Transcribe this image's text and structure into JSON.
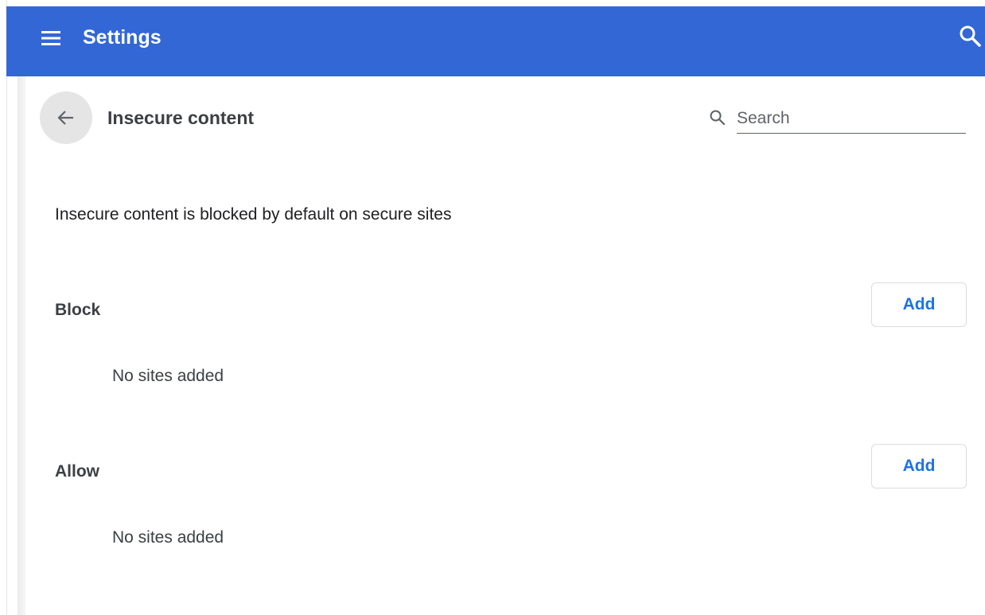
{
  "header": {
    "title": "Settings",
    "menu_icon": "hamburger-menu-icon",
    "search_icon": "search-icon",
    "background_color": "#3367d6"
  },
  "subpage": {
    "title": "Insecure content",
    "back_icon": "arrow-back-icon",
    "search": {
      "placeholder": "Search",
      "value": ""
    }
  },
  "description": "Insecure content is blocked by default on secure sites",
  "sections": [
    {
      "label": "Block",
      "add_label": "Add",
      "empty_text": "No sites added"
    },
    {
      "label": "Allow",
      "add_label": "Add",
      "empty_text": "No sites added"
    }
  ],
  "accent_color": "#1a73e8"
}
